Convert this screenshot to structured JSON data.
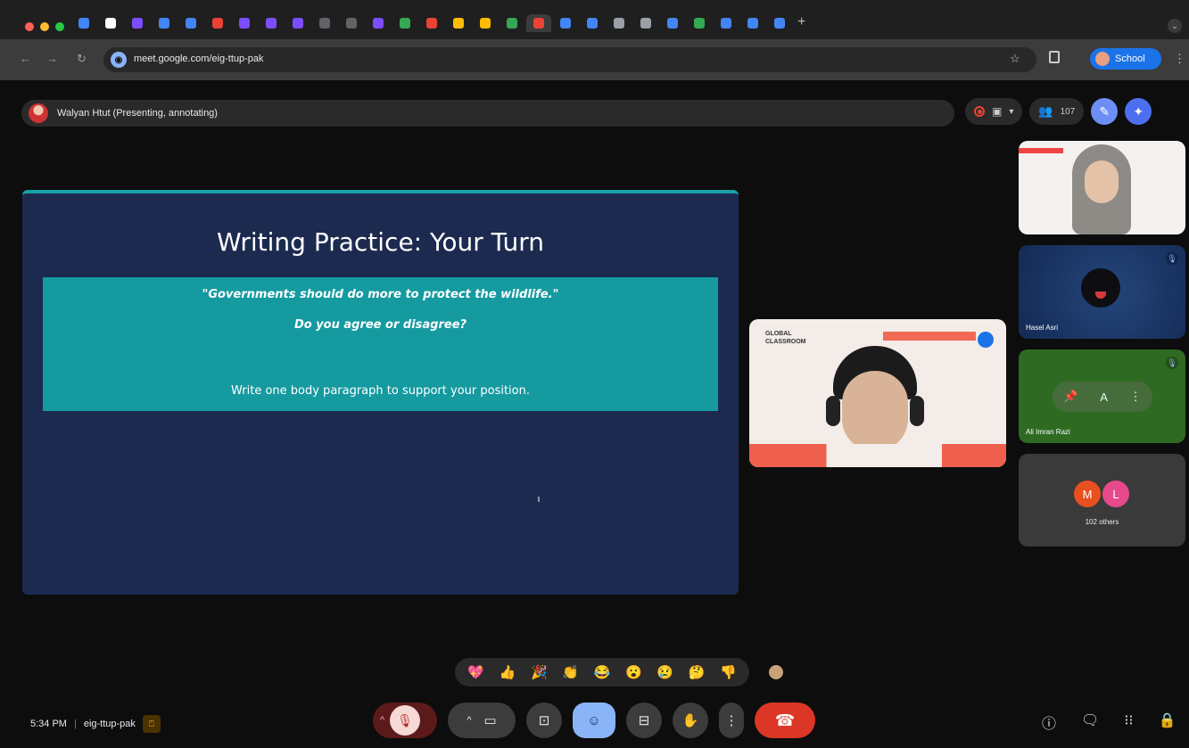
{
  "browser": {
    "url": "meet.google.com/eig-ttup-pak",
    "profile_label": "School",
    "traffic_colors": [
      "#ff5f57",
      "#febc2e",
      "#28c840"
    ],
    "tab_favicon_colors": [
      "#4285f4",
      "#ffffff",
      "#7c4dff",
      "#4285f4",
      "#4285f4",
      "#ea4335",
      "#7c4dff",
      "#7c4dff",
      "#7c4dff",
      "#5f6368",
      "#5f6368",
      "#7c4dff",
      "#34a853",
      "#ea4335",
      "#fbbc04",
      "#fbbc04",
      "#34a853",
      "#ea4335",
      "#4285f4",
      "#4285f4",
      "#9aa0a6",
      "#9aa0a6",
      "#4285f4",
      "#34a853",
      "#4285f4",
      "#4285f4",
      "#4285f4"
    ]
  },
  "meet": {
    "presenter_status": "Walyan Htut (Presenting, annotating)",
    "participant_count": "107",
    "slide": {
      "title": "Writing Practice: Your Turn",
      "quote": "\"Governments should do more to protect the wildlife.\"",
      "question": "Do you agree or disagree?",
      "task": "Write one body paragraph to support your position."
    },
    "pinned": {
      "logo_text": "GLOBAL CLASSROOM"
    },
    "tiles": [
      {
        "name": "",
        "type": "video-woman"
      },
      {
        "name": "Hasel Asri",
        "type": "avatar"
      },
      {
        "name": "Ali Imran Razi",
        "type": "controls"
      }
    ],
    "others": {
      "initials": [
        "M",
        "L"
      ],
      "colors": [
        "#e8501f",
        "#e64a8c"
      ],
      "label": "102 others"
    },
    "reactions": [
      "💖",
      "👍",
      "🎉",
      "👏",
      "😂",
      "😮",
      "😢",
      "🤔",
      "👎"
    ],
    "bottom": {
      "time": "5:34 PM",
      "separator": "|",
      "code": "eig-ttup-pak"
    },
    "accent_colors": {
      "end_call": "#dc3626",
      "slide_bg": "#1b2a4e",
      "slide_box": "#159aa0"
    }
  }
}
